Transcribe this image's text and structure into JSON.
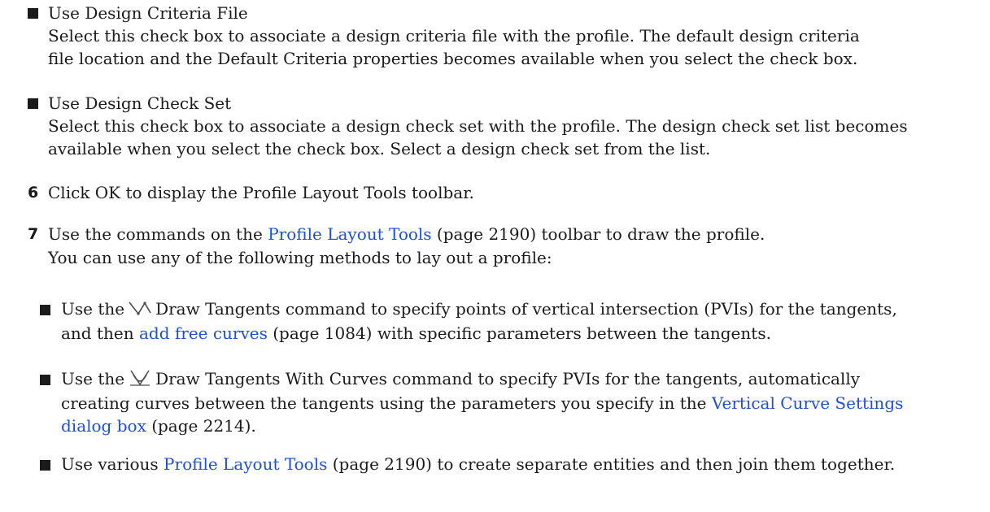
{
  "options": [
    {
      "title": "Use Design Criteria File",
      "lines": [
        "Select this check box to associate a design criteria file with the profile. The default design criteria",
        "file location and the Default Criteria properties becomes available when you select the check box."
      ]
    },
    {
      "title": "Use Design Check Set",
      "lines": [
        "Select this check box to associate a design check set with the profile. The design check set list becomes",
        "available when you select the check box. Select a design check set from the list."
      ]
    }
  ],
  "steps": [
    {
      "number": "6",
      "text": "Click OK to display the Profile Layout Tools toolbar."
    },
    {
      "number": "7",
      "pre": "Use the commands on the ",
      "link": "Profile Layout Tools",
      "ref": " (page 2190)",
      "post": " toolbar to draw the profile.",
      "sub": "You can use any of the following methods to lay out a profile:"
    }
  ],
  "methods": [
    {
      "pre": "Use the",
      "icon": "draw-tangents-icon",
      "line1_rest": "Draw Tangents command to specify points of vertical intersection (PVIs) for the tangents,",
      "line2_pre": "and then ",
      "line2_link": "add free curves",
      "line2_ref": " (page 1084)",
      "line2_post": " with specific parameters between the tangents."
    },
    {
      "pre": "Use the",
      "icon": "draw-tangents-with-curves-icon",
      "line1_rest": "Draw Tangents With Curves command to specify PVIs for the tangents, automatically",
      "line2_pre": "creating curves between the tangents using the parameters you specify in the ",
      "line2_link": "Vertical Curve Settings",
      "line3_link": "dialog box",
      "line3_ref": " (page 2214)",
      "line3_post": "."
    },
    {
      "pre": "Use various ",
      "link": "Profile Layout Tools",
      "ref": " (page 2190)",
      "post": " to create separate entities and then join them together."
    }
  ]
}
